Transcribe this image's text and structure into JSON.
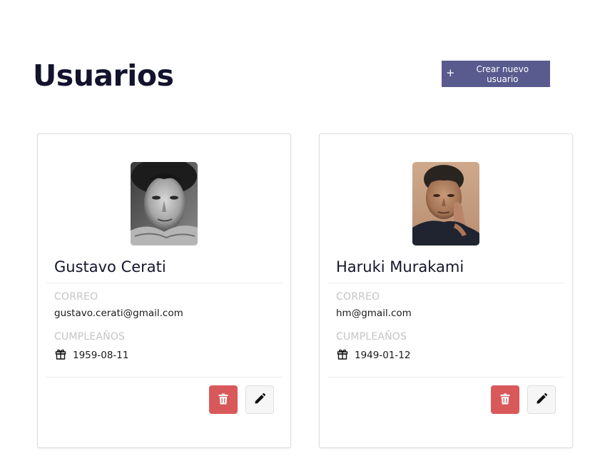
{
  "header": {
    "title": "Usuarios",
    "create_button_label": "Crear nuevo usuario",
    "create_button_icon": "plus-icon"
  },
  "labels": {
    "email": "CORREO",
    "birthday": "CUMPLEAÑOS"
  },
  "users": [
    {
      "name": "Gustavo Cerati",
      "email": "gustavo.cerati@gmail.com",
      "birthday": "1959-08-11",
      "photo": "grayscale portrait"
    },
    {
      "name": "Haruki Murakami",
      "email": "hm@gmail.com",
      "birthday": "1949-01-12",
      "photo": "color portrait"
    }
  ],
  "icons": {
    "birthday": "gift-icon",
    "delete": "trash-icon",
    "edit": "pencil-icon"
  },
  "colors": {
    "title": "#13132e",
    "primary_button": "#595b8e",
    "danger_button": "#d9595b",
    "edit_button": "#f6f6f6",
    "label_muted": "#c4c4c4"
  }
}
